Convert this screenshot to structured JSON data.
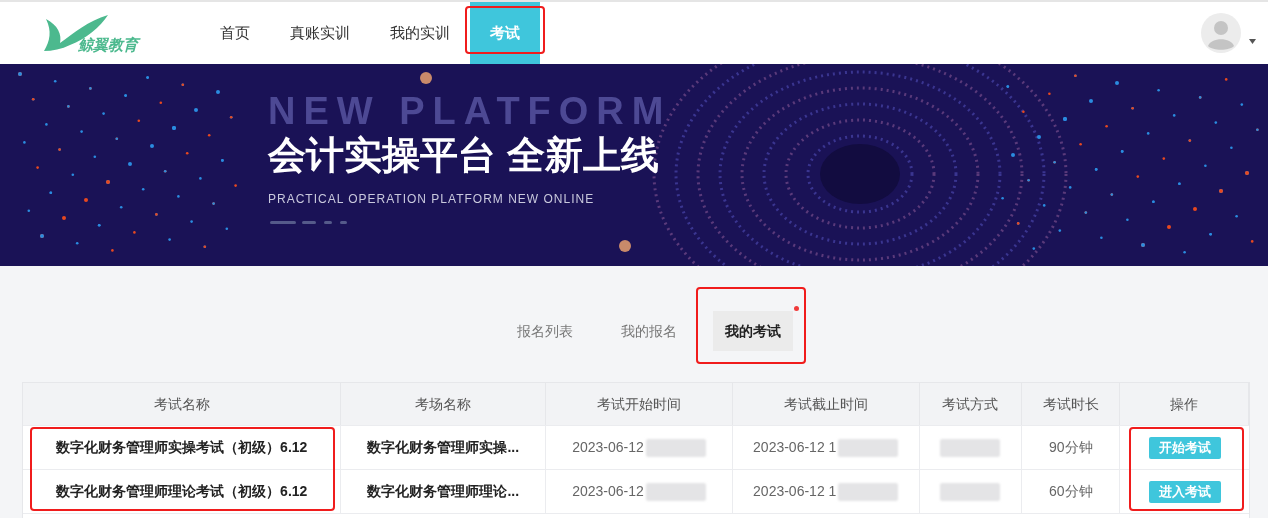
{
  "logo": {
    "text": "鲸翼教育"
  },
  "nav": [
    {
      "label": "首页",
      "selected": false,
      "highlighted": false
    },
    {
      "label": "真账实训",
      "selected": false,
      "highlighted": false
    },
    {
      "label": "我的实训",
      "selected": false,
      "highlighted": false
    },
    {
      "label": "考试",
      "selected": true,
      "highlighted": true
    }
  ],
  "banner": {
    "watermark_text": "NEW PLATFORM",
    "headline": "会计实操平台 全新上线",
    "subtitle": "PRACTICAL OPERATION PLATFORM NEW ONLINE"
  },
  "sub_tabs": [
    {
      "label": "报名列表",
      "selected": false,
      "highlighted": false,
      "dot": false
    },
    {
      "label": "我的报名",
      "selected": false,
      "highlighted": false,
      "dot": false
    },
    {
      "label": "我的考试",
      "selected": true,
      "highlighted": true,
      "dot": true
    }
  ],
  "table": {
    "columns": [
      {
        "label": "考试名称",
        "highlighted": true
      },
      {
        "label": "考场名称",
        "highlighted": false
      },
      {
        "label": "考试开始时间",
        "highlighted": false
      },
      {
        "label": "考试截止时间",
        "highlighted": false
      },
      {
        "label": "考试方式",
        "highlighted": false
      },
      {
        "label": "考试时长",
        "highlighted": false
      },
      {
        "label": "操作",
        "highlighted": true
      }
    ],
    "rows": [
      {
        "cells": [
          {
            "text": "数字化财务管理师实操考试（初级）6.12",
            "blurred": false
          },
          {
            "text": "数字化财务管理师实操...",
            "blurred": false
          },
          {
            "text": "2023-06-12",
            "blurred": true
          },
          {
            "text": "2023-06-12 1",
            "blurred": true
          },
          {
            "blurred": true
          },
          {
            "text": "90分钟",
            "blurred": false
          }
        ],
        "action": "开始考试"
      },
      {
        "cells": [
          {
            "text": "数字化财务管理师理论考试（初级）6.12",
            "blurred": false
          },
          {
            "text": "数字化财务管理师理论...",
            "blurred": false
          },
          {
            "text": "2023-06-12",
            "blurred": true
          },
          {
            "text": "2023-06-12 1",
            "blurred": true
          },
          {
            "blurred": true
          },
          {
            "text": "60分钟",
            "blurred": false
          }
        ],
        "action": "进入考试"
      }
    ]
  }
}
